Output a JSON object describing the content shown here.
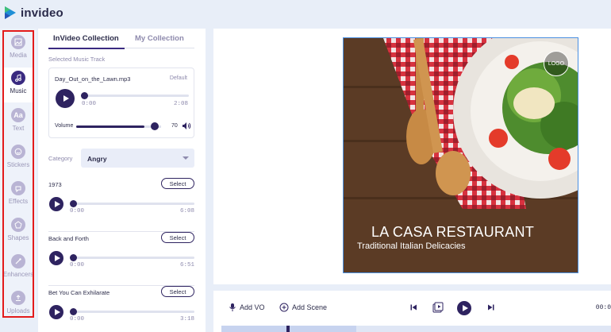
{
  "app": {
    "name": "invideo"
  },
  "sidebar": {
    "items": [
      {
        "label": "Media",
        "icon": "image-icon"
      },
      {
        "label": "Music",
        "icon": "music-note-icon",
        "active": true
      },
      {
        "label": "Text",
        "icon": "text-icon"
      },
      {
        "label": "Stickers",
        "icon": "smiley-icon"
      },
      {
        "label": "Effects",
        "icon": "effects-icon"
      },
      {
        "label": "Shapes",
        "icon": "shapes-icon"
      },
      {
        "label": "Enhancers",
        "icon": "wand-icon"
      },
      {
        "label": "Uploads",
        "icon": "upload-icon"
      }
    ]
  },
  "panel": {
    "tabs": [
      "InVideo Collection",
      "My Collection"
    ],
    "active_tab": 0,
    "selected_label": "Selected Music Track",
    "current": {
      "name": "Day_Out_on_the_Lawn.mp3",
      "badge": "Default",
      "elapsed": "0:00",
      "duration": "2:08",
      "progress": 0,
      "volume_label": "Volume",
      "volume": "70"
    },
    "category_label": "Category",
    "category_value": "Angry",
    "select_label": "Select",
    "tracks": [
      {
        "title": "1973",
        "elapsed": "0:00",
        "duration": "6:08"
      },
      {
        "title": "Back and Forth",
        "elapsed": "0:00",
        "duration": "6:51"
      },
      {
        "title": "Bet You Can Exhilarate",
        "elapsed": "0:00",
        "duration": "3:18"
      }
    ]
  },
  "preview": {
    "title": "LA CASA RESTAURANT",
    "subtitle": "Traditional Italian Delicacies",
    "logo": "LOGO"
  },
  "toolbar": {
    "add_vo": "Add VO",
    "add_scene": "Add Scene",
    "time": "00:0"
  },
  "colors": {
    "accent": "#2e2360",
    "highlight": "#e31b1b",
    "selection": "#4a90e2"
  }
}
